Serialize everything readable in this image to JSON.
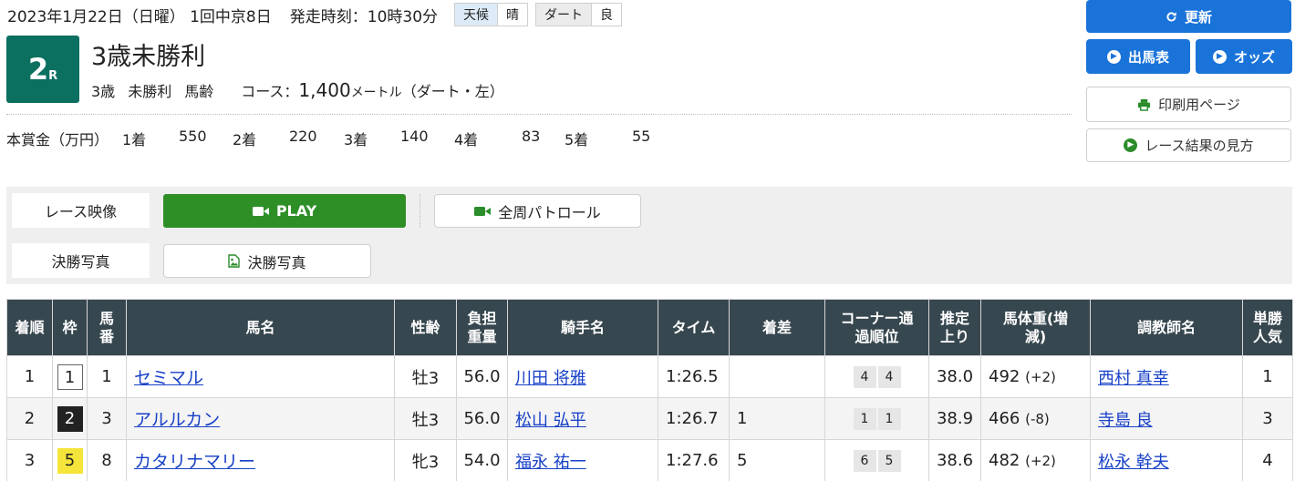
{
  "header": {
    "date": "2023年1月22日（日曜） 1回中京8日",
    "start_time": "発走時刻：10時30分",
    "weather_key": "天候",
    "weather_val": "晴",
    "track_key": "ダート",
    "track_val": "良"
  },
  "race": {
    "number": "2",
    "suffix": "R",
    "title": "3歳未勝利",
    "cond1": "3歳",
    "cond2": "未勝利",
    "cond3": "馬齢",
    "course_label": "コース：",
    "distance": "1,400",
    "unit": "メートル",
    "surface": "（ダート・左）"
  },
  "prize": {
    "label": "本賞金（万円）",
    "items": [
      {
        "place": "1着",
        "amount": "550"
      },
      {
        "place": "2着",
        "amount": "220"
      },
      {
        "place": "3着",
        "amount": "140"
      },
      {
        "place": "4着",
        "amount": "83"
      },
      {
        "place": "5着",
        "amount": "55"
      }
    ]
  },
  "buttons": {
    "refresh": "更新",
    "entries": "出馬表",
    "odds": "オッズ",
    "print": "印刷用ページ",
    "guide": "レース結果の見方"
  },
  "media": {
    "video_label": "レース映像",
    "play": "PLAY",
    "patrol": "全周パトロール",
    "photo_label": "決勝写真",
    "photo_button": "決勝写真"
  },
  "table": {
    "headers": [
      "着順",
      "枠",
      "馬番",
      "馬名",
      "性齢",
      "負担重量",
      "騎手名",
      "タイム",
      "着差",
      "コーナー通過順位",
      "推定上り",
      "馬体重(増減)",
      "調教師名",
      "単勝人気"
    ],
    "rows": [
      {
        "place": "1",
        "waku": "1",
        "umaban": "1",
        "horse": "セミマル",
        "sex_age": "牡3",
        "weight": "56.0",
        "jockey": "川田 将雅",
        "time": "1:26.5",
        "margin": "",
        "corner1": "4",
        "corner2": "4",
        "last3f": "38.0",
        "body": "492",
        "body_diff": "(+2)",
        "trainer": "西村 真幸",
        "pop": "1"
      },
      {
        "place": "2",
        "waku": "2",
        "umaban": "3",
        "horse": "アルルカン",
        "sex_age": "牡3",
        "weight": "56.0",
        "jockey": "松山 弘平",
        "time": "1:26.7",
        "margin": "1",
        "corner1": "1",
        "corner2": "1",
        "last3f": "38.9",
        "body": "466",
        "body_diff": "(-8)",
        "trainer": "寺島 良",
        "pop": "3"
      },
      {
        "place": "3",
        "waku": "5",
        "umaban": "8",
        "horse": "カタリナマリー",
        "sex_age": "牝3",
        "weight": "54.0",
        "jockey": "福永 祐一",
        "time": "1:27.6",
        "margin": "5",
        "corner1": "6",
        "corner2": "5",
        "last3f": "38.6",
        "body": "482",
        "body_diff": "(+2)",
        "trainer": "松永 幹夫",
        "pop": "4"
      }
    ]
  },
  "colors": {
    "race_tile": "#0b7060",
    "primary_button": "#1a73d9",
    "play_button": "#2f8f27",
    "table_header": "#37474f",
    "link": "#1740c7",
    "waku_1": "#ffffff",
    "waku_2": "#222222",
    "waku_5": "#f5e53a"
  },
  "icons": {
    "refresh": "refresh-icon",
    "entries": "chevron-circle-icon",
    "odds": "chevron-circle-icon",
    "print": "printer-icon",
    "guide": "chevron-circle-icon",
    "play": "video-camera-icon",
    "patrol": "video-camera-icon",
    "photo": "image-icon"
  }
}
